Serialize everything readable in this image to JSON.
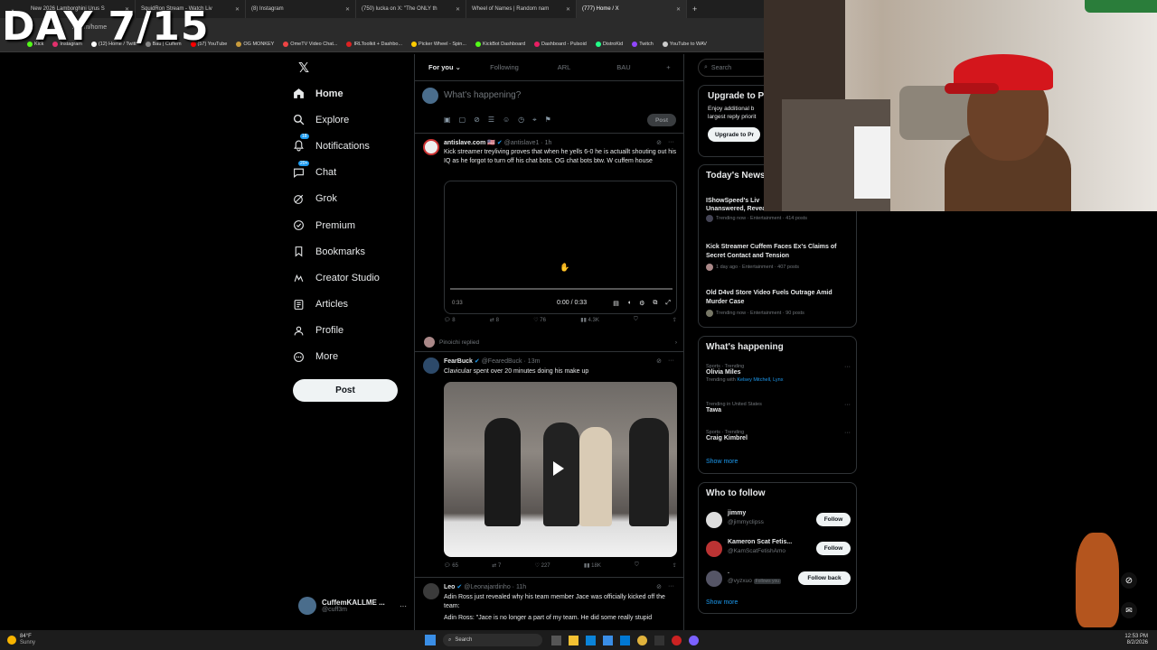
{
  "overlay_title": "DAY 7/15",
  "browser": {
    "tabs": [
      {
        "label": "New 2026 Lamborghini Urus S",
        "active": false
      },
      {
        "label": "SquidRon Stream - Watch Liv",
        "active": false
      },
      {
        "label": "(8) Instagram",
        "active": false
      },
      {
        "label": "(750) lucka on X: \"The ONLY th",
        "active": false
      },
      {
        "label": "Wheel of Names | Random nam",
        "active": false
      },
      {
        "label": "(777) Home / X",
        "active": true
      }
    ],
    "url": "x.com/home",
    "bookmarks": [
      "Kick",
      "Instagram",
      "(12) Home / Twitt",
      "Bau | Cuffem",
      "(57) YouTube",
      "OG MONKEY",
      "OmeTV Video Chat...",
      "IRLToolkit + Dashbo...",
      "Picker Wheel - Spin...",
      "KickBot Dashboard",
      "Dashboard - Pulsoid",
      "DistroKid",
      "Twitch",
      "YouTube to WAV"
    ]
  },
  "nav": {
    "items": [
      {
        "label": "Home",
        "icon": "home-icon",
        "active": true
      },
      {
        "label": "Explore",
        "icon": "search-icon"
      },
      {
        "label": "Notifications",
        "icon": "bell-icon",
        "badge": "18"
      },
      {
        "label": "Chat",
        "icon": "chat-icon",
        "badge": "20+"
      },
      {
        "label": "Grok",
        "icon": "grok-icon"
      },
      {
        "label": "Premium",
        "icon": "premium-icon"
      },
      {
        "label": "Bookmarks",
        "icon": "bookmark-icon"
      },
      {
        "label": "Creator Studio",
        "icon": "creator-studio-icon"
      },
      {
        "label": "Articles",
        "icon": "articles-icon"
      },
      {
        "label": "Profile",
        "icon": "profile-icon"
      },
      {
        "label": "More",
        "icon": "more-circle-icon"
      }
    ],
    "post_label": "Post",
    "account": {
      "name": "CuffemKALLME ...",
      "handle": "@cuff3m"
    }
  },
  "feed": {
    "tabs": [
      "For you",
      "Following",
      "ARL",
      "BAU"
    ],
    "compose_placeholder": "What's happening?",
    "compose_post_label": "Post",
    "tweets": [
      {
        "name": "antislave.com 🇺🇸",
        "handle": "@antislave1",
        "time": "1h",
        "text": "Kick streamer treyliving proves that when he yells 6-0 he is actuallt shouting out his IQ as he forgot to turn off his chat bots. OG chat bots btw. W cuffem house",
        "video_time": "0:00 / 0:33",
        "video_duration_badge": "0:33",
        "replies": "8",
        "reposts": "8",
        "likes": "76",
        "views": "4.3K",
        "replied_by": "Pinoichi replied"
      },
      {
        "name": "FearBuck",
        "handle": "@FearedBuck",
        "time": "13m",
        "text": "Clavicular spent over 20 minutes doing his make up",
        "replies": "65",
        "reposts": "7",
        "likes": "227",
        "views": "18K"
      },
      {
        "name": "Leo",
        "handle": "@Leonajardinho",
        "time": "11h",
        "text": "Adin Ross just revealed why his team member Jace was officially kicked off the team:",
        "text2": "Adin Ross: \"Jace is no longer a part of my team. He did some really stupid"
      }
    ]
  },
  "right": {
    "search_placeholder": "Search",
    "premium": {
      "title": "Upgrade to P",
      "text": "Enjoy additional b largest reply priorit",
      "button": "Upgrade to Pr"
    },
    "news": {
      "title": "Today's News",
      "items": [
        {
          "title": "IShowSpeed's Liv Unanswered, Revea",
          "meta": "Trending now · Entertainment · 414 posts"
        },
        {
          "title": "Kick Streamer Cuffem Faces Ex's Claims of Secret Contact and Tension",
          "meta": "1 day ago · Entertainment · 407 posts"
        },
        {
          "title": "Old D4vd Store Video Fuels Outrage Amid Murder Case",
          "meta": "Trending now · Entertainment · 90 posts"
        }
      ]
    },
    "happening": {
      "title": "What's happening",
      "items": [
        {
          "cat": "Sports · Trending",
          "title": "Olivia Miles",
          "extra_prefix": "Trending with",
          "extra": "Kelsey Mitchell, Lynx"
        },
        {
          "cat": "Trending in United States",
          "title": "Tawa"
        },
        {
          "cat": "Sports · Trending",
          "title": "Craig Kimbrel"
        }
      ],
      "show_more": "Show more"
    },
    "who_to_follow": {
      "title": "Who to follow",
      "users": [
        {
          "name": "jimmy",
          "handle": "@jimmyclipss",
          "button": "Follow"
        },
        {
          "name": "Kameron Scat Fetis...",
          "handle": "@KamScatFetishAmo",
          "button": "Follow"
        },
        {
          "name": ".",
          "handle": "@vyzxuo",
          "follows_you": "Follows you",
          "button": "Follow back"
        }
      ],
      "show_more": "Show more"
    }
  },
  "taskbar": {
    "weather_temp": "84°F",
    "weather_desc": "Sunny",
    "search": "Search",
    "time": "12:53 PM",
    "date": "8/2/2026"
  },
  "colors": {
    "accent": "#1d9bf0",
    "bg": "#000000",
    "border": "#2f3336",
    "muted": "#71767b"
  }
}
